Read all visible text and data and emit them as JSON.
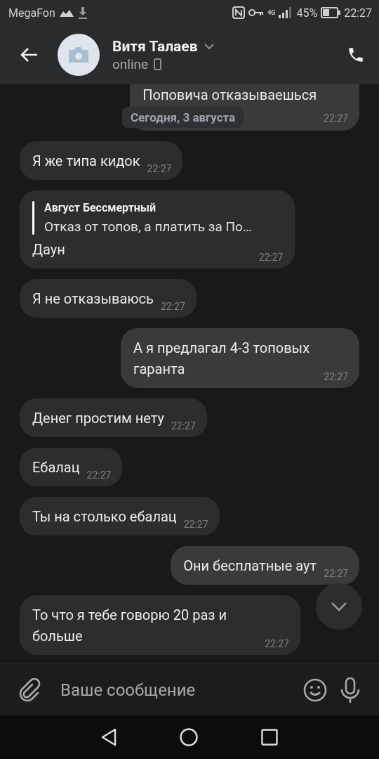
{
  "status_bar": {
    "carrier": "MegaFon",
    "network": "4G",
    "battery": "45%",
    "time": "22:27"
  },
  "header": {
    "name": "Витя Талаев",
    "status": "online"
  },
  "date_label": "Сегодня, 3 августа",
  "messages": [
    {
      "kind": "outgoing",
      "text": "Поповича отказываешься",
      "time": "22:27"
    },
    {
      "kind": "incoming",
      "text": "Я же типа кидок",
      "time": "22:27"
    },
    {
      "kind": "incoming",
      "reply": {
        "author": "Август Бессмертный",
        "text": "Отказ от топов, а платить за По…"
      },
      "text": "Даун",
      "time": "22:27"
    },
    {
      "kind": "incoming",
      "text": "Я не отказываюсь",
      "time": "22:27"
    },
    {
      "kind": "outgoing",
      "text": "А я предлагал 4-3 топовых гаранта",
      "time": "22:27"
    },
    {
      "kind": "incoming",
      "text": "Денег простим нету",
      "time": "22:27"
    },
    {
      "kind": "incoming",
      "text": "Ебалац",
      "time": "22:27"
    },
    {
      "kind": "incoming",
      "text": "Ты на столько ебалац",
      "time": "22:27"
    },
    {
      "kind": "outgoing",
      "text": "Они бесплатные аут",
      "time": "22:27"
    },
    {
      "kind": "incoming",
      "text": "То что я тебе говорю 20 раз и больше",
      "time": "22:27"
    }
  ],
  "composer": {
    "placeholder": "Ваше сообщение"
  }
}
